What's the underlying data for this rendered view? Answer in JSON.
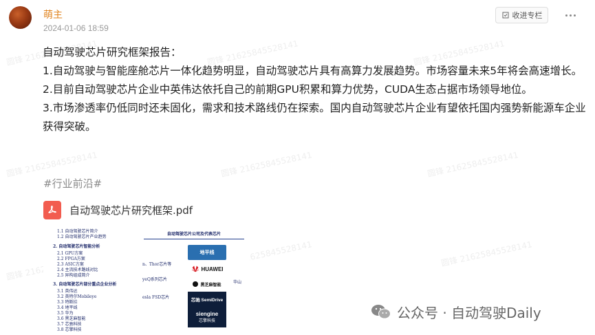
{
  "post": {
    "author": "萌主",
    "date": "2024-01-06 18:59",
    "collect_label": "收进专栏",
    "paragraphs": [
      "自动驾驶芯片研究框架报告：",
      "1.自动驾驶与智能座舱芯片一体化趋势明显，自动驾驶芯片具有高算力发展趋势。市场容量未来5年将会高速增长。",
      "2.目前自动驾驶芯片企业中英伟达依托自己的前期GPU积累和算力优势，CUDA生态占据市场领导地位。",
      "3.市场渗透率仍低同时还未固化，需求和技术路线仍在探索。国内自动驾驶芯片企业有望依托国内强势新能源车企业获得突破。"
    ],
    "hashtag": "#行业前沿#",
    "attachment": "自动驾驶芯片研究框架.pdf"
  },
  "thumb1": {
    "lines": [
      "1.1 自动驾驶芯片简介",
      "1.2 自动驾驶芯片产业趋势",
      "2. 自动驾驶芯片智能分析",
      "2.1 GPU方案",
      "2.2 FPGA方案",
      "2.3 ASIC方案",
      "2.4 主流技术路线对比",
      "2.5 异构组成简介",
      "3. 自动驾驶芯片部分重点企业分析",
      "3.1 英伟达",
      "3.2 英特尔Mobileye",
      "3.3 特斯拉",
      "3.4 地平线",
      "3.5 华为",
      "3.6 黑芝麻智能",
      "3.7 芯驰科技",
      "3.8 芯擎科技"
    ]
  },
  "thumb2": {
    "title": "自动驾驶芯片公司及代表芯片",
    "side_labels": [
      "n、Thor芯片等",
      "yeQ系列芯片",
      "esla FSD芯片"
    ],
    "side_right": "华山",
    "logos": {
      "horizon": "地平线",
      "huawei": "HUAWEI",
      "blacksesame": "黑芝麻智能",
      "semidrive": "芯驰 SemiDrive",
      "siengine": "siengine",
      "siengine_cn": "芯擎科技"
    }
  },
  "watermark_text": "圆锋 21625845528141",
  "footer": {
    "brand": "公众号 · 自动驾驶Daily"
  }
}
